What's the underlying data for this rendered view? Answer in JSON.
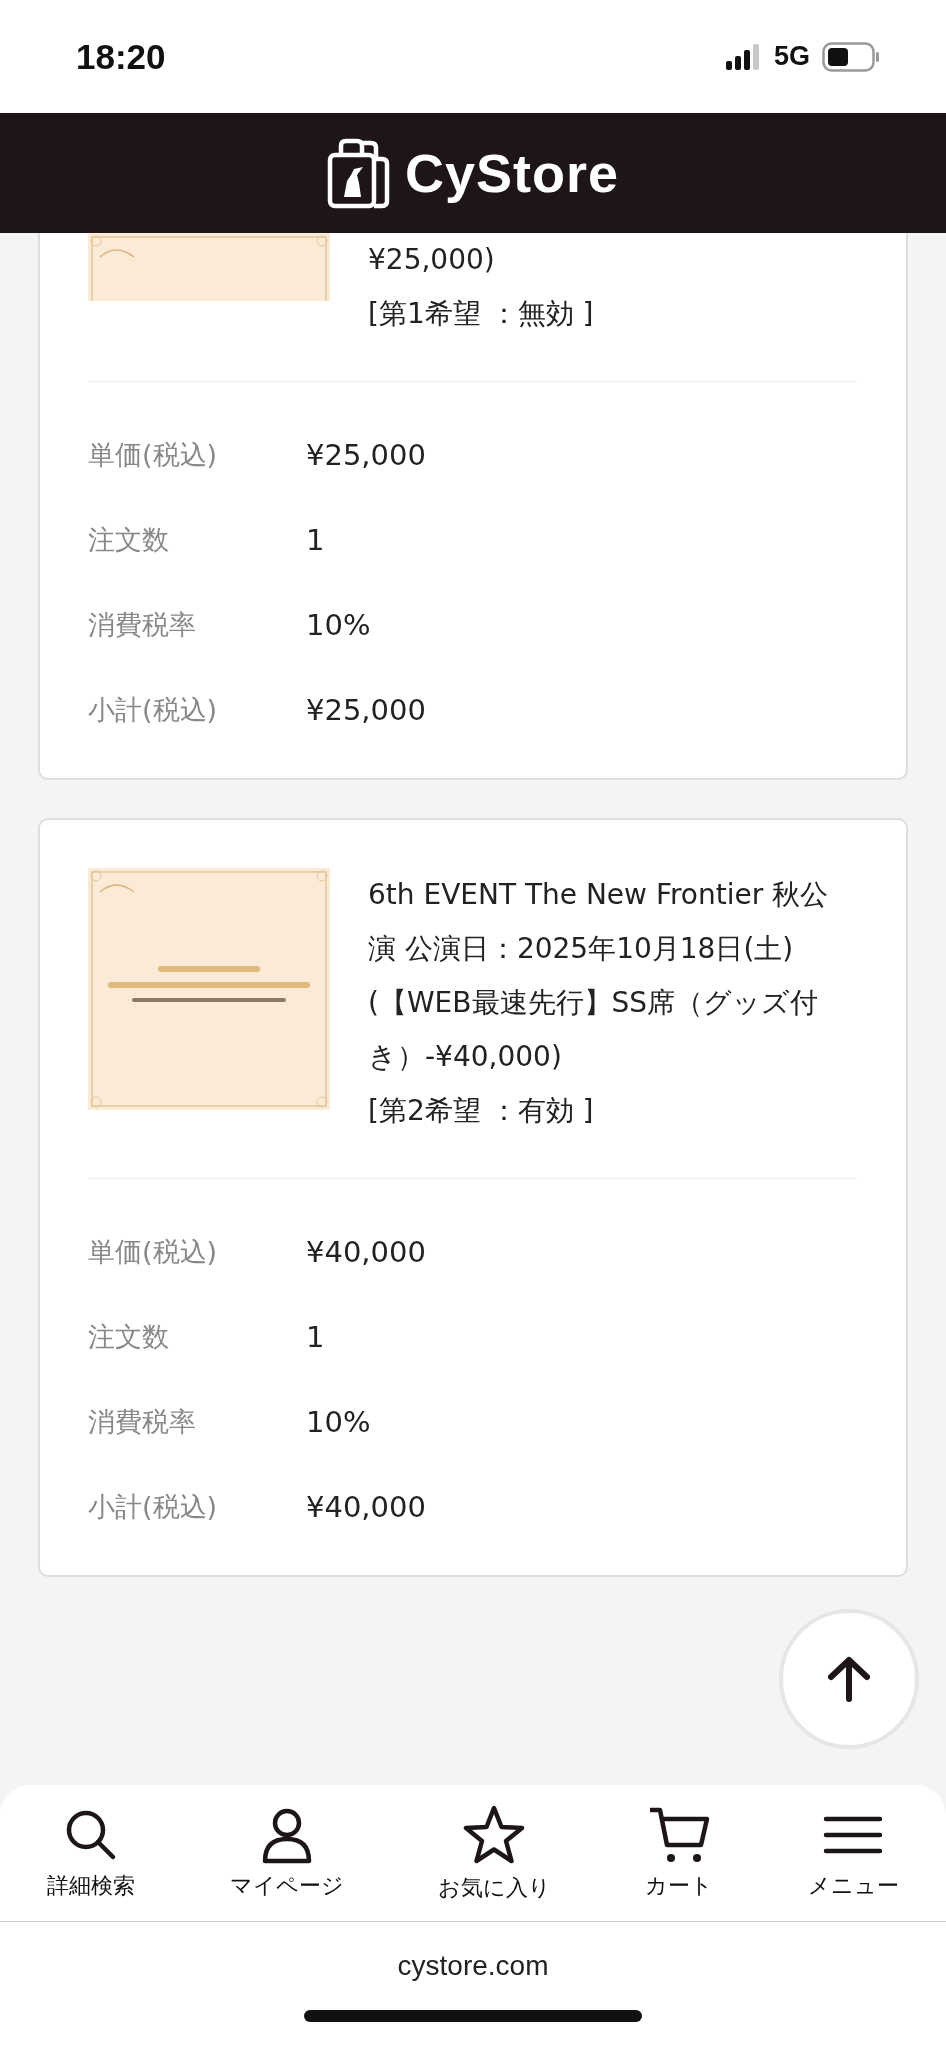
{
  "status_bar": {
    "time": "18:20",
    "network": "5G"
  },
  "header": {
    "logo_text": "CyStore"
  },
  "orders": [
    {
      "cut_top": true,
      "title": "¥25,000)",
      "choice": "[第1希望 ：無効 ]",
      "details": [
        {
          "label": "単価(税込)",
          "value": "¥25,000"
        },
        {
          "label": "注文数",
          "value": "1"
        },
        {
          "label": "消費税率",
          "value": "10%"
        },
        {
          "label": "小計(税込)",
          "value": "¥25,000"
        }
      ]
    },
    {
      "cut_top": false,
      "title": "6th EVENT The New Frontier 秋公演 公演日：2025年10月18日(土)(【WEB最速先行】SS席（グッズ付き）-¥40,000)",
      "choice": "[第2希望 ：有効 ]",
      "details": [
        {
          "label": "単価(税込)",
          "value": "¥40,000"
        },
        {
          "label": "注文数",
          "value": "1"
        },
        {
          "label": "消費税率",
          "value": "10%"
        },
        {
          "label": "小計(税込)",
          "value": "¥40,000"
        }
      ]
    }
  ],
  "bottom_nav": [
    {
      "label": "詳細検索"
    },
    {
      "label": "マイページ"
    },
    {
      "label": "お気に入り"
    },
    {
      "label": "カート"
    },
    {
      "label": "メニュー"
    }
  ],
  "browser_bar": {
    "url": "cystore.com"
  }
}
